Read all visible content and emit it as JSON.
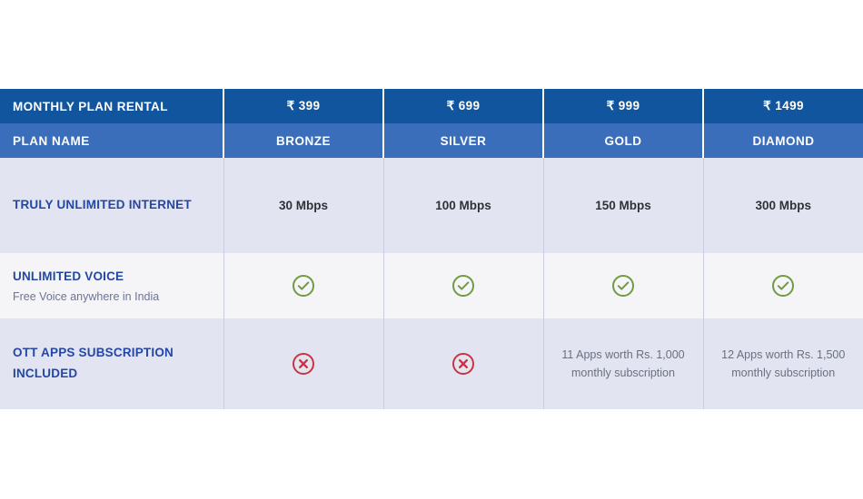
{
  "table": {
    "header": {
      "rental": {
        "label": "MONTHLY PLAN RENTAL",
        "prices": [
          "₹ 399",
          "₹ 699",
          "₹ 999",
          "₹ 1499"
        ]
      },
      "plan_name": {
        "label": "PLAN NAME",
        "names": [
          "BRONZE",
          "SILVER",
          "GOLD",
          "DIAMOND"
        ]
      }
    },
    "rows": [
      {
        "title": "TRULY UNLIMITED INTERNET",
        "subtitle": "",
        "values": [
          "30 Mbps",
          "100 Mbps",
          "150 Mbps",
          "300 Mbps"
        ]
      },
      {
        "title": "UNLIMITED VOICE",
        "subtitle": "Free Voice anywhere in India",
        "values": [
          "check-circle-icon",
          "check-circle-icon",
          "check-circle-icon",
          "check-circle-icon"
        ]
      },
      {
        "title": "OTT APPS SUBSCRIPTION INCLUDED",
        "subtitle": "",
        "values": [
          "cross-circle-icon",
          "cross-circle-icon",
          "11 Apps worth Rs. 1,000 monthly subscription",
          "12 Apps worth Rs. 1,500 monthly subscription"
        ]
      }
    ]
  },
  "colors": {
    "header_dark_blue": "#11559f",
    "header_medium_blue": "#3a6dba",
    "row_band_lavender": "#e2e5f1",
    "row_band_light": "#f5f5f7",
    "label_blue": "#2447a5",
    "check_green": "#6f9b43",
    "cross_red": "#c8353f"
  }
}
